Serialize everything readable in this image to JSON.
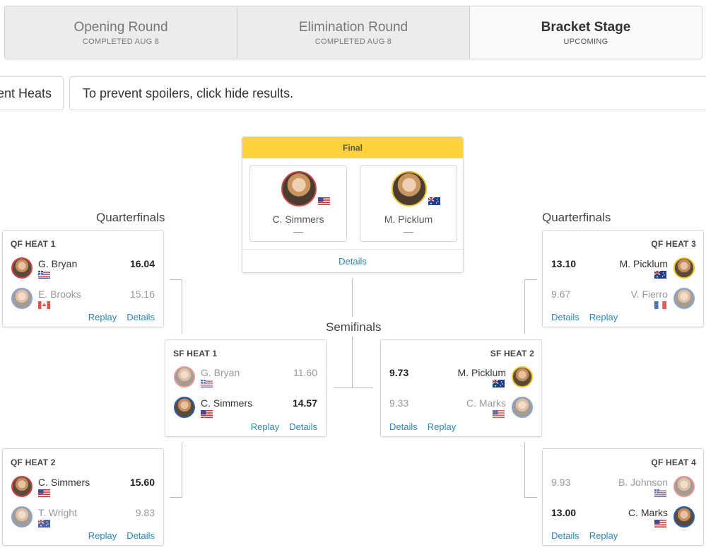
{
  "rounds": [
    {
      "name": "Opening Round",
      "status": "COMPLETED AUG 8"
    },
    {
      "name": "Elimination Round",
      "status": "COMPLETED AUG 8"
    },
    {
      "name": "Bracket Stage",
      "status": "UPCOMING"
    }
  ],
  "subbar": {
    "all_heats_label": "ent Heats",
    "spoiler_text": "To prevent spoilers, click hide results."
  },
  "sections": {
    "quarterfinals_left": "Quarterfinals",
    "quarterfinals_right": "Quarterfinals",
    "semifinals": "Semifinals"
  },
  "final": {
    "title": "Final",
    "details_label": "Details",
    "finalists": [
      {
        "name": "C. Simmers",
        "score": "—",
        "flag": "usa"
      },
      {
        "name": "M. Picklum",
        "score": "—",
        "flag": "aus"
      }
    ]
  },
  "heats": {
    "qf1": {
      "title": "QF HEAT 1",
      "surfers": [
        {
          "name": "G. Bryan",
          "score": "16.04",
          "flag": "hawaii"
        },
        {
          "name": "E. Brooks",
          "score": "15.16",
          "flag": "canada"
        }
      ],
      "replay_label": "Replay",
      "details_label": "Details"
    },
    "qf2": {
      "title": "QF HEAT 2",
      "surfers": [
        {
          "name": "C. Simmers",
          "score": "15.60",
          "flag": "usa"
        },
        {
          "name": "T. Wright",
          "score": "9.83",
          "flag": "aus"
        }
      ],
      "replay_label": "Replay",
      "details_label": "Details"
    },
    "qf3": {
      "title": "QF HEAT 3",
      "surfers": [
        {
          "name": "M. Picklum",
          "score": "13.10",
          "flag": "aus"
        },
        {
          "name": "V. Fierro",
          "score": "9.67",
          "flag": "france"
        }
      ],
      "replay_label": "Replay",
      "details_label": "Details"
    },
    "qf4": {
      "title": "QF HEAT 4",
      "surfers": [
        {
          "name": "B. Johnson",
          "score": "9.93",
          "flag": "hawaii"
        },
        {
          "name": "C. Marks",
          "score": "13.00",
          "flag": "usa"
        }
      ],
      "replay_label": "Replay",
      "details_label": "Details"
    },
    "sf1": {
      "title": "SF HEAT 1",
      "surfers": [
        {
          "name": "G. Bryan",
          "score": "11.60",
          "flag": "hawaii"
        },
        {
          "name": "C. Simmers",
          "score": "14.57",
          "flag": "usa"
        }
      ],
      "replay_label": "Replay",
      "details_label": "Details"
    },
    "sf2": {
      "title": "SF HEAT 2",
      "surfers": [
        {
          "name": "M. Picklum",
          "score": "9.73",
          "flag": "aus"
        },
        {
          "name": "C. Marks",
          "score": "9.33",
          "flag": "usa"
        }
      ],
      "replay_label": "Replay",
      "details_label": "Details"
    }
  },
  "colors": {
    "final_header": "#fdd23c",
    "link": "#2b87b8"
  }
}
